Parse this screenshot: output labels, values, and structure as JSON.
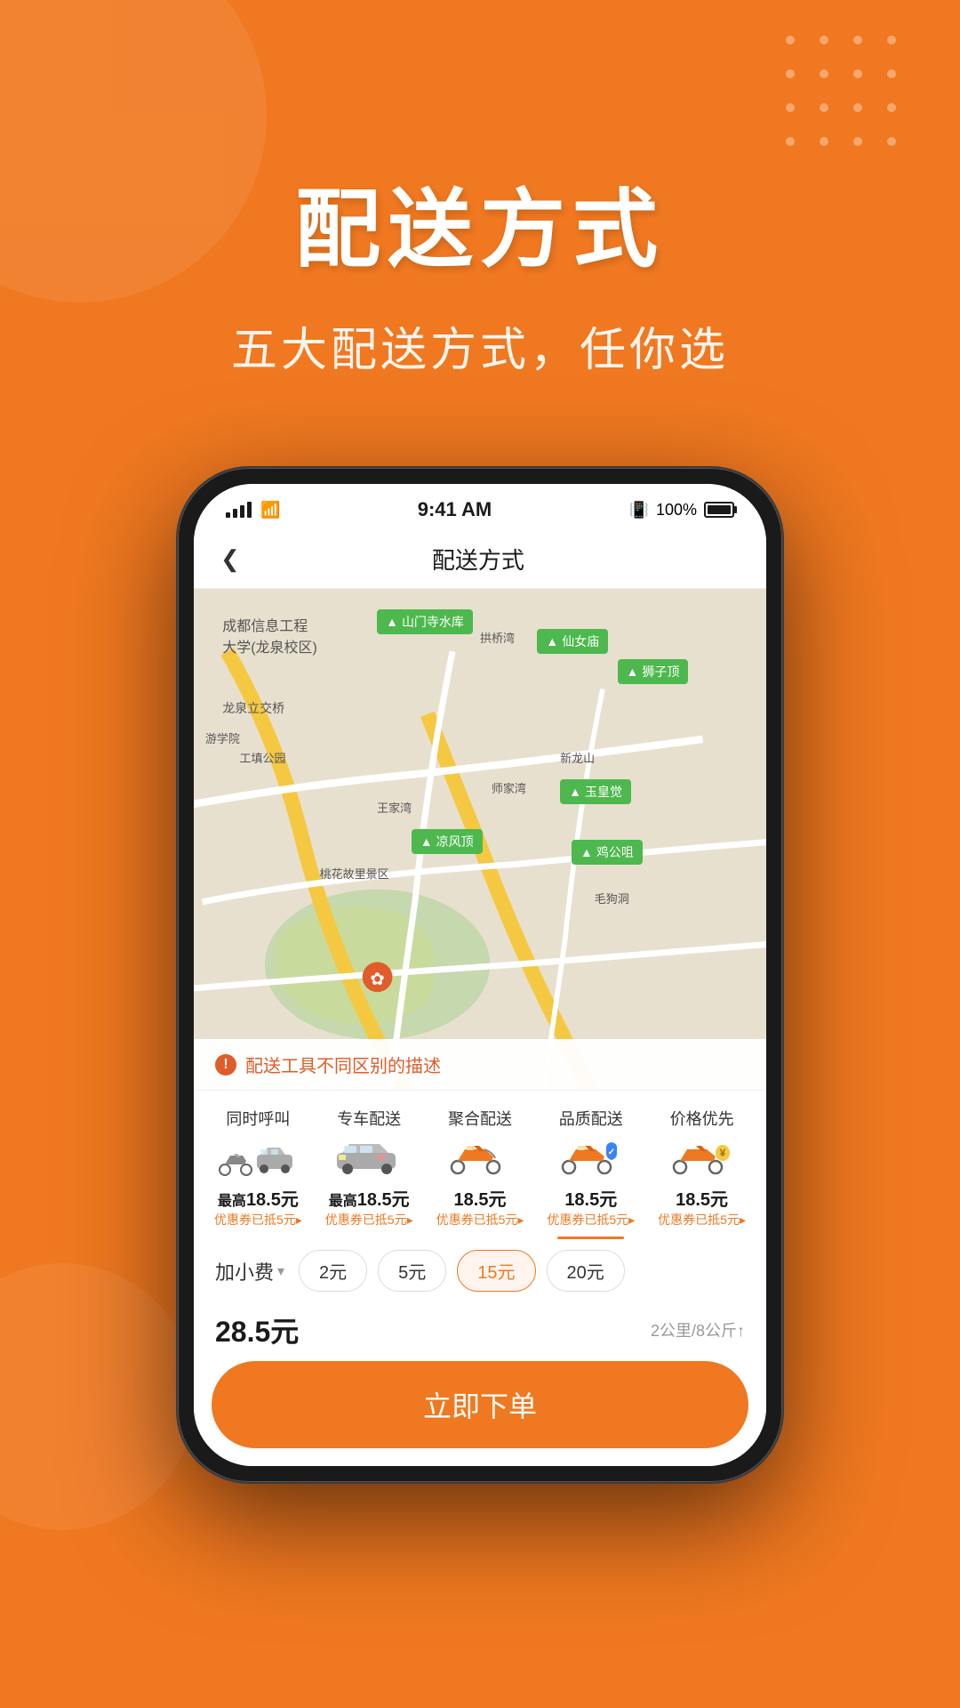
{
  "page": {
    "bg_color": "#F07820"
  },
  "hero": {
    "title": "配送方式",
    "subtitle": "五大配送方式，任你选"
  },
  "phone": {
    "status_bar": {
      "time": "9:41 AM",
      "battery": "100%"
    },
    "nav": {
      "title": "配送方式"
    },
    "map": {
      "warning": "配送工具不同区别的描述"
    },
    "delivery_tabs": [
      {
        "name": "同时呼叫",
        "price": "最高18.5元",
        "coupon": "优惠券已抵5元▸",
        "active": false,
        "vehicle": "moto+car"
      },
      {
        "name": "专车配送",
        "price": "最高18.5元",
        "coupon": "优惠券已抵5元▸",
        "active": false,
        "vehicle": "car"
      },
      {
        "name": "聚合配送",
        "price": "18.5元",
        "coupon": "优惠券已抵5元▸",
        "active": false,
        "vehicle": "moto"
      },
      {
        "name": "品质配送",
        "price": "18.5元",
        "coupon": "优惠券已抵5元▸",
        "active": true,
        "vehicle": "moto-shield"
      },
      {
        "name": "价格优先",
        "price": "18.5元",
        "coupon": "优惠券已抵5元▸",
        "active": false,
        "vehicle": "moto-bag"
      }
    ],
    "extra_fee": {
      "label": "加小费",
      "options": [
        "2元",
        "5元",
        "15元",
        "20元"
      ],
      "selected": "15元"
    },
    "total": {
      "price": "28.5元",
      "info": "2公里/8公斤↑"
    },
    "order_btn": "立即下单",
    "map_labels": [
      {
        "text": "山门寺水库",
        "top": "12%",
        "left": "42%"
      },
      {
        "text": "仙女庙",
        "top": "14%",
        "left": "66%"
      },
      {
        "text": "狮子顶",
        "top": "16%",
        "left": "78%"
      },
      {
        "text": "玉皇觉",
        "top": "40%",
        "left": "67%"
      },
      {
        "text": "鸡公咀",
        "top": "52%",
        "left": "70%"
      },
      {
        "text": "凉风顶",
        "top": "52%",
        "left": "46%"
      },
      {
        "text": "桃花故里景区",
        "top": "65%",
        "left": "38%"
      }
    ]
  }
}
